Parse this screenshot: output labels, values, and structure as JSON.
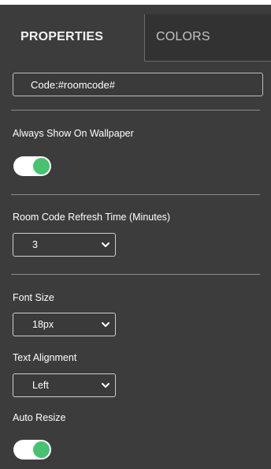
{
  "tabs": {
    "properties": "PROPERTIES",
    "colors": "COLORS"
  },
  "code_field": {
    "value": "Code:#roomcode#"
  },
  "always_show": {
    "label": "Always Show On Wallpaper",
    "enabled": true
  },
  "refresh": {
    "label": "Room Code Refresh Time (Minutes)",
    "value": "3"
  },
  "font_size": {
    "label": "Font Size",
    "value": "18px"
  },
  "text_alignment": {
    "label": "Text Alignment",
    "value": "Left"
  },
  "auto_resize": {
    "label": "Auto Resize",
    "enabled": true
  },
  "colors": {
    "panel_bg": "#3c3c3c",
    "toggle_on": "#46c270"
  },
  "icons": [
    "chevron-down-icon"
  ]
}
